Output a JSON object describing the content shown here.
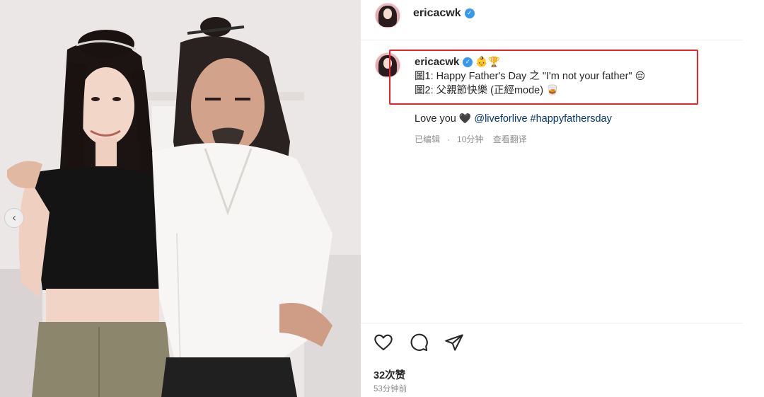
{
  "post": {
    "username": "ericacwk",
    "verified_glyph": "✓",
    "carousel_prev_glyph": "‹",
    "caption": {
      "emojis": "👶🏆",
      "line1_text": "圖1: Happy Father's Day 之 \"I'm not your father\"",
      "line1_emoji": "😔",
      "line2_text": "圖2: 父親節快樂 (正經mode)",
      "line2_emoji": "🥃"
    },
    "extra": {
      "text": "Love you",
      "heart_emoji": "🖤",
      "mention": "@liveforlive",
      "hashtag": "#happyfathersday"
    },
    "meta": {
      "edited": "已编辑",
      "dot": "·",
      "time": "10分钟",
      "translate": "查看翻译"
    },
    "likes": "32次赞",
    "posted": "53分钟前"
  },
  "icons": {
    "like": "heart-outline-icon",
    "comment": "comment-bubble-icon",
    "share": "paper-plane-icon",
    "prev": "chevron-left-icon",
    "verified": "verified-badge-icon"
  },
  "colors": {
    "highlight": "#e8232b",
    "link": "#00376b",
    "verified": "#3897f0",
    "muted": "#8e8e8e"
  }
}
